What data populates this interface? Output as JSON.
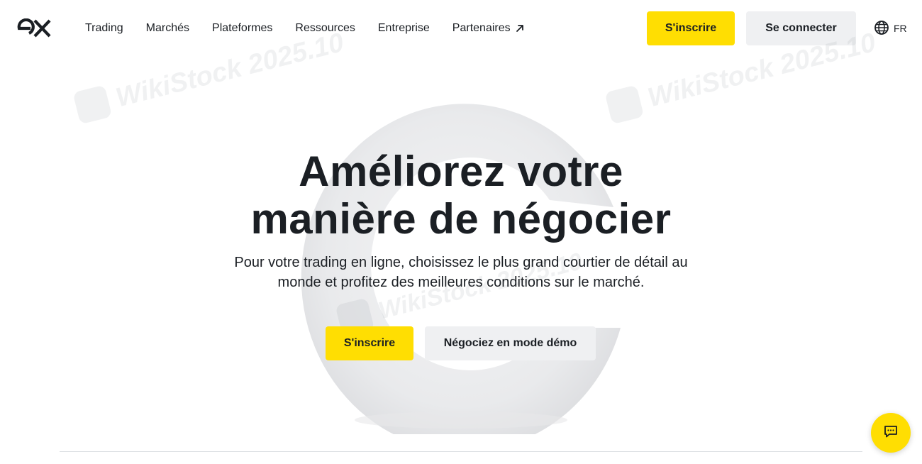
{
  "header": {
    "logo_icon": "exness-ex-logo-icon",
    "nav": [
      {
        "label": "Trading"
      },
      {
        "label": "Marchés"
      },
      {
        "label": "Plateformes"
      },
      {
        "label": "Ressources"
      },
      {
        "label": "Entreprise"
      },
      {
        "label": "Partenaires",
        "icon": "external-arrow-icon"
      }
    ],
    "signup_label": "S'inscrire",
    "login_label": "Se connecter",
    "language": {
      "icon": "globe-icon",
      "code": "FR"
    }
  },
  "watermark": {
    "text": "WikiStock 2025.10",
    "icon": "wikistock-logo-icon"
  },
  "hero": {
    "title_line1": "Améliorez votre",
    "title_line2": "manière de négocier",
    "subtitle_line1": "Pour votre trading en ligne, choisissez le plus grand courtier de détail au",
    "subtitle_line2": "monde et profitez des meilleures conditions sur le marché.",
    "signup_label": "S'inscrire",
    "demo_label": "Négociez en mode démo",
    "art_icon": "large-3d-e-letter-graphic"
  },
  "chat": {
    "icon": "chat-bubble-icon"
  },
  "colors": {
    "accent_yellow": "#ffde02",
    "button_gray": "#eff0f2",
    "text_dark": "#1b1f24"
  }
}
